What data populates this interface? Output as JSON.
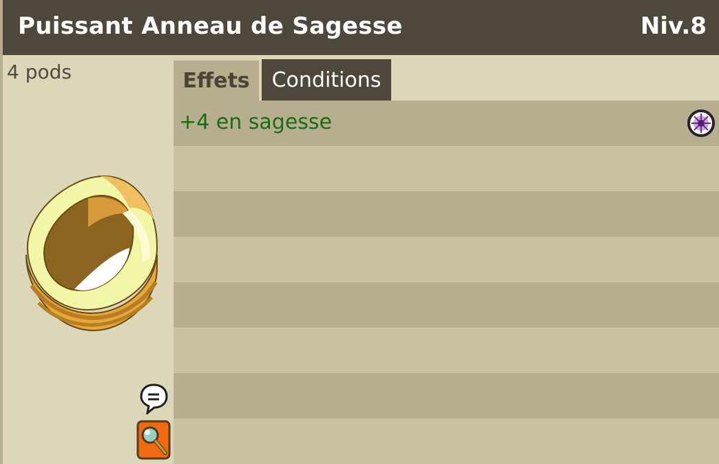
{
  "header": {
    "item_name": "Puissant Anneau de Sagesse",
    "level": "Niv.8"
  },
  "left": {
    "weight": "4 pods",
    "item_icon": "gold-ring-icon",
    "chat_icon": "speech-bubble-icon",
    "inspect_icon": "magnifier-icon"
  },
  "tabs": {
    "active": "Effets",
    "inactive": "Conditions"
  },
  "effects": [
    {
      "text": "+4 en sagesse",
      "icon": "wisdom-eye-icon"
    }
  ],
  "colors": {
    "header_bg": "#4e473b",
    "panel_bg": "#dcd7b9",
    "row_dark": "#b7ae8f",
    "row_light": "#c9c1a0",
    "effect_text": "#1a6d12"
  }
}
